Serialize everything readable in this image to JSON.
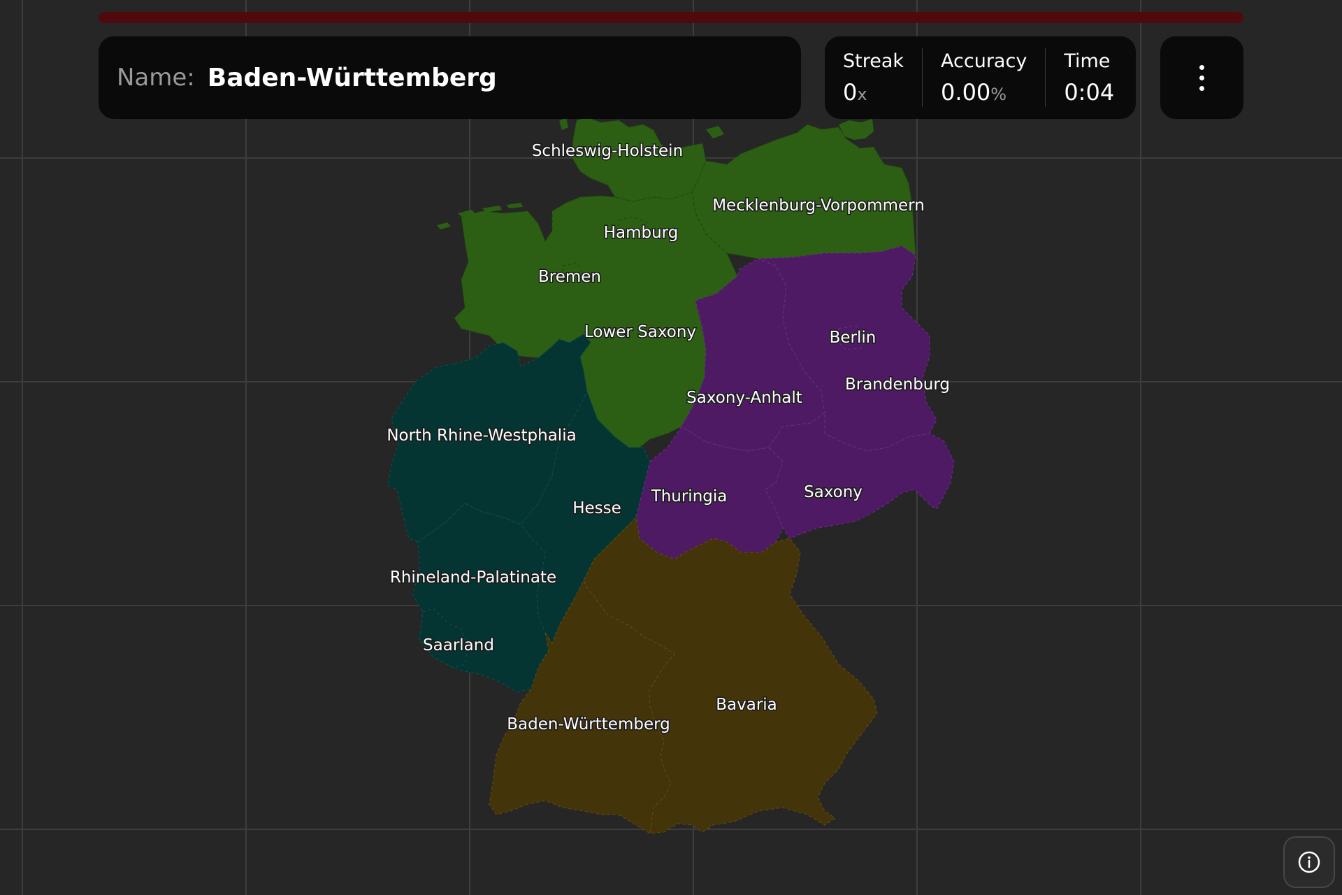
{
  "header": {
    "progress_percent": 0,
    "name_label": "Name:",
    "name_value": "Baden-Württemberg"
  },
  "stats": {
    "streak": {
      "label": "Streak",
      "value": "0",
      "unit": "x"
    },
    "accuracy": {
      "label": "Accuracy",
      "value": "0.00",
      "unit": "%"
    },
    "time": {
      "label": "Time",
      "value": "0:04"
    }
  },
  "menu": {
    "icon": "more-vertical-icon"
  },
  "info": {
    "icon": "info-icon"
  },
  "colors": {
    "background": "#262626",
    "grid": "#3d3d3d",
    "panel": "#0a0a0a",
    "progress_track": "#4e0a0d",
    "north": "#2c5f14",
    "west": "#043532",
    "east": "#4e1a63",
    "south": "#443409"
  },
  "map": {
    "regions": [
      {
        "name": "Schleswig-Holstein"
      },
      {
        "name": "Mecklenburg-Vorpommern"
      },
      {
        "name": "Hamburg"
      },
      {
        "name": "Bremen"
      },
      {
        "name": "Lower Saxony"
      },
      {
        "name": "Berlin"
      },
      {
        "name": "Brandenburg"
      },
      {
        "name": "Saxony-Anhalt"
      },
      {
        "name": "North Rhine-Westphalia"
      },
      {
        "name": "Hesse"
      },
      {
        "name": "Thuringia"
      },
      {
        "name": "Saxony"
      },
      {
        "name": "Rhineland-Palatinate"
      },
      {
        "name": "Saarland"
      },
      {
        "name": "Bavaria"
      },
      {
        "name": "Baden-Württemberg"
      }
    ]
  }
}
